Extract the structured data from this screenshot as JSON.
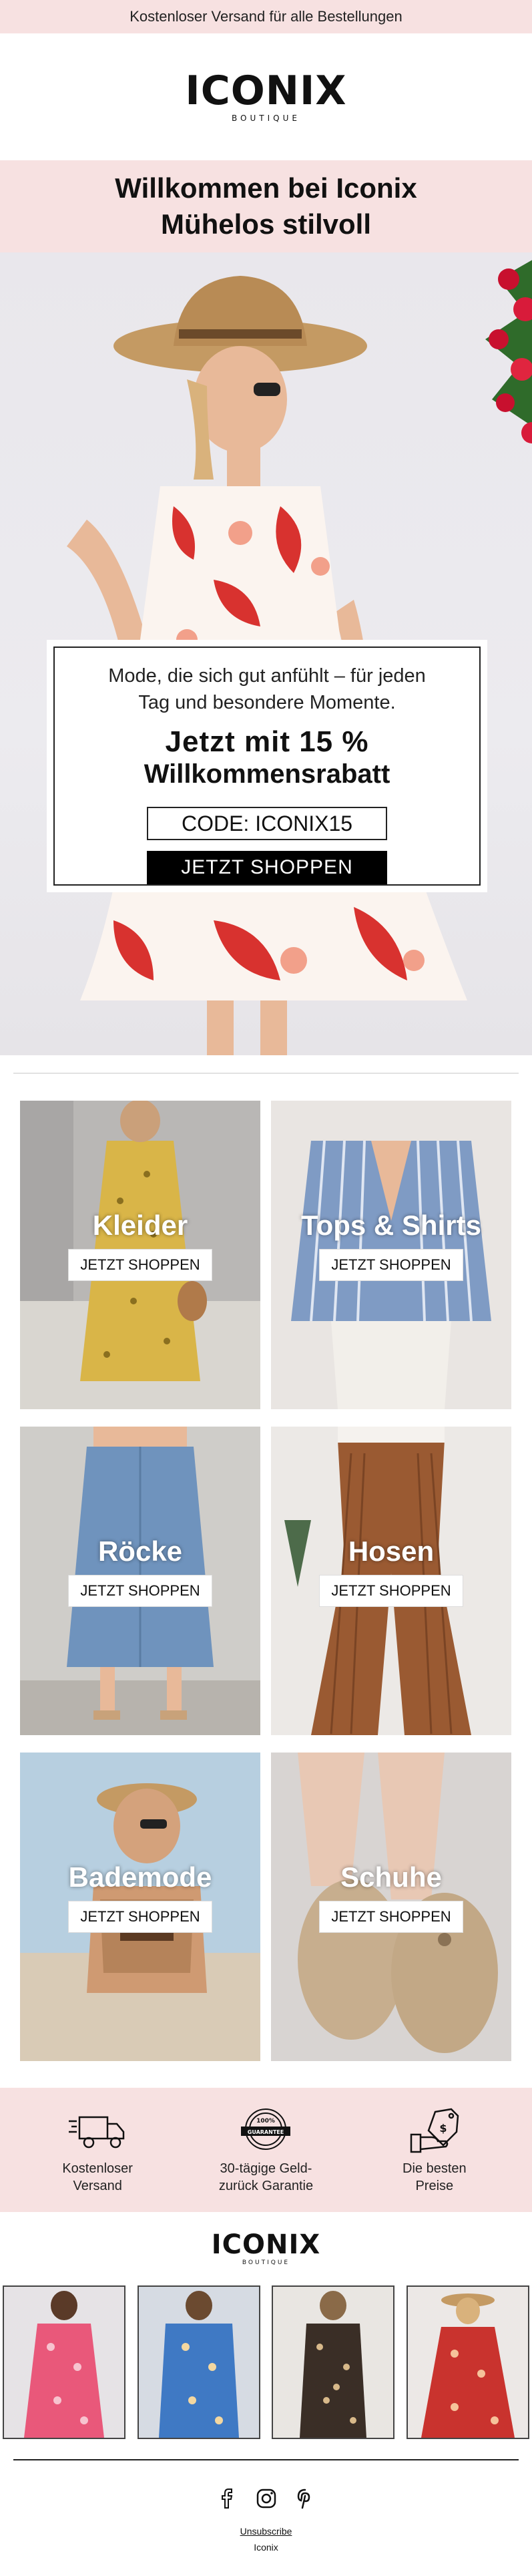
{
  "topbar": {
    "text": "Kostenloser Versand für alle Bestellungen"
  },
  "logo": {
    "main": "ICONIX",
    "sub": "BOUTIQUE"
  },
  "welcome": {
    "line1": "Willkommen bei Iconix",
    "line2": "Mühelos stilvoll"
  },
  "offer": {
    "sub_line1": "Mode, die sich gut anfühlt – für jeden",
    "sub_line2": "Tag und besondere Momente.",
    "title_line1": "Jetzt mit 15 %",
    "title_line2": "Willkommensrabatt",
    "code": "CODE: ICONIX15",
    "button": "JETZT SHOPPEN"
  },
  "categories": [
    {
      "label": "Kleider",
      "button": "JETZT SHOPPEN"
    },
    {
      "label": "Tops & Shirts",
      "button": "JETZT SHOPPEN"
    },
    {
      "label": "Röcke",
      "button": "JETZT SHOPPEN"
    },
    {
      "label": "Hosen",
      "button": "JETZT SHOPPEN"
    },
    {
      "label": "Bademode",
      "button": "JETZT SHOPPEN"
    },
    {
      "label": "Schuhe",
      "button": "JETZT SHOPPEN"
    }
  ],
  "features": [
    {
      "icon": "truck-icon",
      "line1": "Kostenloser",
      "line2": "Versand"
    },
    {
      "icon": "guarantee-badge-icon",
      "badge_top": "100%",
      "badge_text": "GUARANTEE",
      "line1": "30-tägige Geld-",
      "line2": "zurück Garantie"
    },
    {
      "icon": "price-tag-hand-icon",
      "line1": "Die besten",
      "line2": "Preise"
    }
  ],
  "footer": {
    "socials": [
      "facebook-icon",
      "instagram-icon",
      "pinterest-icon"
    ],
    "unsubscribe": "Unsubscribe",
    "brand": "Iconix"
  },
  "colors": {
    "accent_pink": "#f7e1e1",
    "button_black": "#000000"
  }
}
